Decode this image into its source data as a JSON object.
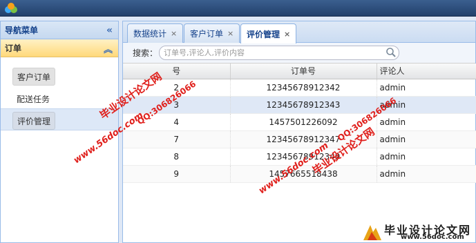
{
  "sidebar": {
    "title": "导航菜单",
    "collapse_icon": "double-chevron-left-icon",
    "group": {
      "label": "订单",
      "toggle_icon": "double-chevron-up-icon"
    },
    "items": [
      {
        "label": "客户订单"
      },
      {
        "label": "配送任务"
      },
      {
        "label": "评价管理"
      }
    ]
  },
  "tabs": [
    {
      "label": "数据统计",
      "close": "×"
    },
    {
      "label": "客户订单",
      "close": "×"
    },
    {
      "label": "评价管理",
      "close": "×"
    }
  ],
  "search": {
    "label": "搜索：",
    "placeholder": "订单号,评论人,评价内容",
    "icon": "search-icon"
  },
  "grid": {
    "columns": [
      "号",
      "订单号",
      "评论人"
    ],
    "rows": [
      {
        "id": "2",
        "order": "12345678912342",
        "reviewer": "admin"
      },
      {
        "id": "3",
        "order": "12345678912343",
        "reviewer": "admin"
      },
      {
        "id": "4",
        "order": "1457501226092",
        "reviewer": "admin"
      },
      {
        "id": "7",
        "order": "12345678912347",
        "reviewer": "admin"
      },
      {
        "id": "8",
        "order": "12345678912349",
        "reviewer": "admin"
      },
      {
        "id": "9",
        "order": "1457665518438",
        "reviewer": "admin"
      }
    ]
  },
  "watermarks": {
    "site_cn": "毕业设计论文网",
    "qq": "QQ:306826066",
    "url": "www.56doc.com",
    "corner_title": "毕业设计论文网",
    "corner_url": "www.56doc.com"
  },
  "colors": {
    "accent": "#15428b",
    "watermark": "#e0201c",
    "header_bar": "#22406b"
  }
}
